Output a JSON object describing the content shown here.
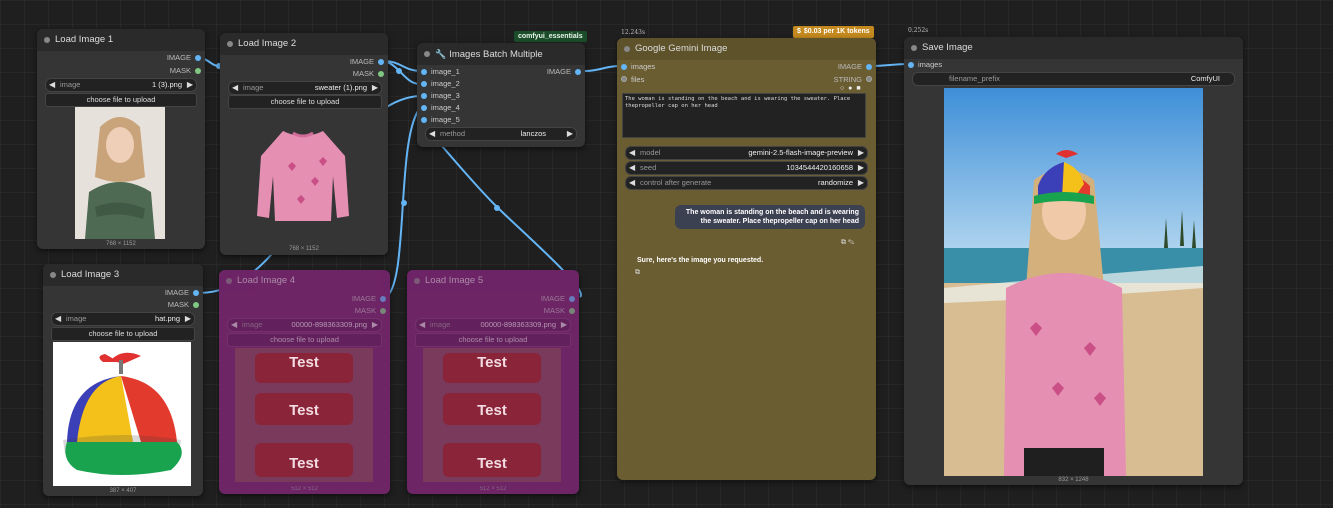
{
  "nodes": {
    "load1": {
      "title": "Load Image 1",
      "out_image": "IMAGE",
      "out_mask": "MASK",
      "image_label": "image",
      "image_value": "1 (3).png",
      "upload": "choose file to upload",
      "dims": "768 × 1152"
    },
    "load2": {
      "title": "Load Image 2",
      "out_image": "IMAGE",
      "out_mask": "MASK",
      "image_label": "image",
      "image_value": "sweater (1).png",
      "upload": "choose file to upload",
      "dims": "768 × 1152"
    },
    "load3": {
      "title": "Load Image 3",
      "out_image": "IMAGE",
      "out_mask": "MASK",
      "image_label": "image",
      "image_value": "hat.png",
      "upload": "choose file to upload",
      "dims": "387 × 407"
    },
    "load4": {
      "title": "Load Image 4",
      "out_image": "IMAGE",
      "out_mask": "MASK",
      "image_label": "image",
      "image_value": "00000-898363309.png",
      "upload": "choose file to upload",
      "dims": "512 × 512",
      "test": "Test"
    },
    "load5": {
      "title": "Load Image 5",
      "out_image": "IMAGE",
      "out_mask": "MASK",
      "image_label": "image",
      "image_value": "00000-898363309.png",
      "upload": "choose file to upload",
      "dims": "512 × 512",
      "test": "Test"
    },
    "batch": {
      "title": "Images Batch Multiple",
      "badge": "comfyui_essentials",
      "out_image": "IMAGE",
      "inputs": [
        "image_1",
        "image_2",
        "image_3",
        "image_4",
        "image_5"
      ],
      "method_label": "method",
      "method_value": "lanczos"
    },
    "gemini": {
      "title": "Google Gemini Image",
      "timing": "12.243s",
      "price": "$0.03 per 1K tokens",
      "price_icon": "$",
      "in_images": "images",
      "in_files": "files",
      "out_image": "IMAGE",
      "out_string": "STRING",
      "prompt": "The woman is standing on the beach and is wearing the sweater. Place thepropeller cap on her head",
      "model_label": "model",
      "model_value": "gemini-2.5-flash-image-preview",
      "seed_label": "seed",
      "seed_value": "1034544420160658",
      "control_label": "control after generate",
      "control_value": "randomize",
      "chat_user": "The woman is standing on the beach and is wearing the sweater. Place thepropeller cap on her head",
      "chat_reply": "Sure, here's the image you requested."
    },
    "save": {
      "title": "Save Image",
      "timing": "0.252s",
      "in_images": "images",
      "prefix_label": "filename_prefix",
      "prefix_value": "ComfyUI",
      "dims": "832 × 1248"
    }
  },
  "colors": {
    "canvas": "#1f1f1f",
    "node": "#353535",
    "gemini_node": "#6b5d32",
    "muted_node": "#6e2566",
    "link": "#64b5f6",
    "mask": "#81c784",
    "badge": "#1b4d2a",
    "price": "#c58a1f"
  }
}
